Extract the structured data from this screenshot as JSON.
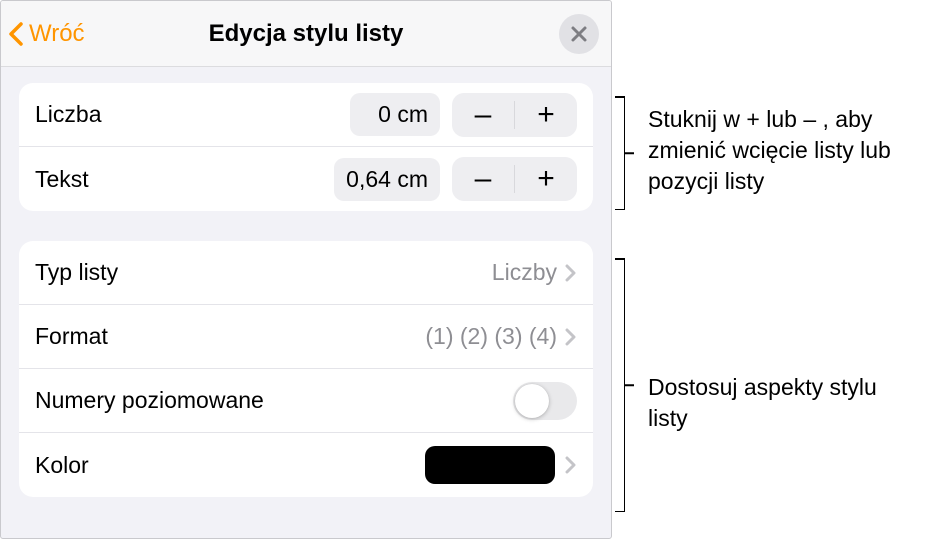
{
  "header": {
    "back_label": "Wróć",
    "title": "Edycja stylu listy"
  },
  "indent": {
    "number_label": "Liczba",
    "number_value": "0 cm",
    "text_label": "Tekst",
    "text_value": "0,64 cm"
  },
  "style": {
    "type_label": "Typ listy",
    "type_value": "Liczby",
    "format_label": "Format",
    "format_value": "(1) (2) (3) (4)",
    "tiered_label": "Numery poziomowane",
    "tiered_on": false,
    "color_label": "Kolor",
    "color_value": "#000000"
  },
  "callouts": {
    "top": "Stuknij w + lub – , aby zmienić wcięcie listy lub pozycji listy",
    "bottom": "Dostosuj aspekty stylu listy"
  },
  "glyphs": {
    "minus": "–",
    "plus": "+"
  }
}
